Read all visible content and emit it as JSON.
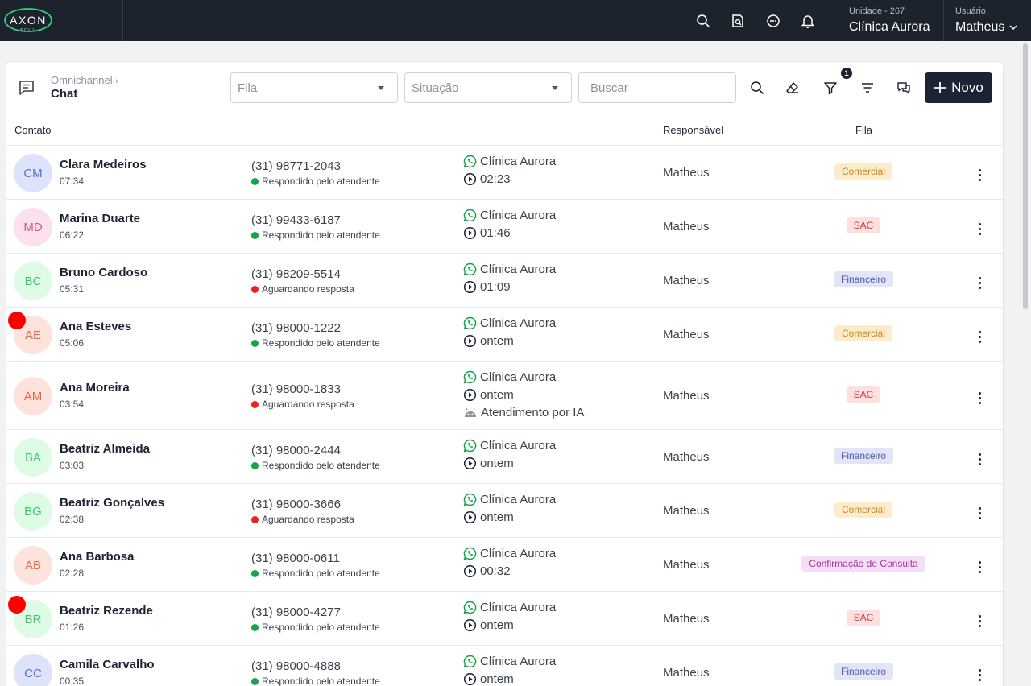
{
  "brand": {
    "logo_text": "AXON",
    "logo_sub": "SOUL"
  },
  "topbar": {
    "icons": [
      "search-icon",
      "document-search-icon",
      "chat-bubble-icon",
      "bell-icon"
    ],
    "unit_label": "Unidade - 267",
    "unit_name": "Clínica Aurora",
    "user_label": "Usuário",
    "user_name": "Matheus"
  },
  "header": {
    "breadcrumb": "Omnichannel",
    "title": "Chat",
    "fila_placeholder": "Fila",
    "situacao_placeholder": "Situação",
    "search_placeholder": "Buscar",
    "filter_badge": "1",
    "new_button": "Novo"
  },
  "columns": {
    "contato": "Contato",
    "responsavel": "Responsável",
    "fila": "Fila"
  },
  "colors": {
    "green": "#16a34a",
    "red": "#ef2020",
    "comercial_bg": "#fdeccc",
    "comercial_fg": "#c9881a",
    "sac_bg": "#fde0e0",
    "sac_fg": "#d63b3b",
    "financeiro_bg": "#e1e5f7",
    "financeiro_fg": "#4c5aa8",
    "confirmacao_bg": "#f4dff7",
    "confirmacao_fg": "#a4329f"
  },
  "rows": [
    {
      "initials": "CM",
      "name": "Clara Medeiros",
      "time": "07:34",
      "phone": "(31) 98771-2043",
      "status": "Respondido pelo atendente",
      "status_color": "green",
      "channel": "Clínica Aurora",
      "last": "02:23",
      "ai": "",
      "responsavel": "Matheus",
      "fila": "Comercial",
      "fila_kind": "comercial",
      "unread": false,
      "avatar_bg": "#dde3fb",
      "avatar_fg": "#5a6fcf"
    },
    {
      "initials": "MD",
      "name": "Marina Duarte",
      "time": "06:22",
      "phone": "(31) 99433-6187",
      "status": "Respondido pelo atendente",
      "status_color": "green",
      "channel": "Clínica Aurora",
      "last": "01:46",
      "ai": "",
      "responsavel": "Matheus",
      "fila": "SAC",
      "fila_kind": "sac",
      "unread": false,
      "avatar_bg": "#fce0ec",
      "avatar_fg": "#d4558a"
    },
    {
      "initials": "BC",
      "name": "Bruno Cardoso",
      "time": "05:31",
      "phone": "(31) 98209-5514",
      "status": "Aguardando resposta",
      "status_color": "red",
      "channel": "Clínica Aurora",
      "last": "01:09",
      "ai": "",
      "responsavel": "Matheus",
      "fila": "Financeiro",
      "fila_kind": "financeiro",
      "unread": false,
      "avatar_bg": "#defbe5",
      "avatar_fg": "#3fc46a"
    },
    {
      "initials": "AE",
      "name": "Ana Esteves",
      "time": "05:06",
      "phone": "(31) 98000-1222",
      "status": "Respondido pelo atendente",
      "status_color": "green",
      "channel": "Clínica Aurora",
      "last": "ontem",
      "ai": "",
      "responsavel": "Matheus",
      "fila": "Comercial",
      "fila_kind": "comercial",
      "unread": true,
      "avatar_bg": "#fde3dc",
      "avatar_fg": "#e0694a"
    },
    {
      "initials": "AM",
      "name": "Ana Moreira",
      "time": "03:54",
      "phone": "(31) 98000-1833",
      "status": "Aguardando resposta",
      "status_color": "red",
      "channel": "Clínica Aurora",
      "last": "ontem",
      "ai": "Atendimento por IA",
      "responsavel": "Matheus",
      "fila": "SAC",
      "fila_kind": "sac",
      "unread": false,
      "avatar_bg": "#fde3dc",
      "avatar_fg": "#e0694a"
    },
    {
      "initials": "BA",
      "name": "Beatriz Almeida",
      "time": "03:03",
      "phone": "(31) 98000-2444",
      "status": "Respondido pelo atendente",
      "status_color": "green",
      "channel": "Clínica Aurora",
      "last": "ontem",
      "ai": "",
      "responsavel": "Matheus",
      "fila": "Financeiro",
      "fila_kind": "financeiro",
      "unread": false,
      "avatar_bg": "#defbe5",
      "avatar_fg": "#3fc46a"
    },
    {
      "initials": "BG",
      "name": "Beatriz Gonçalves",
      "time": "02:38",
      "phone": "(31) 98000-3666",
      "status": "Aguardando resposta",
      "status_color": "red",
      "channel": "Clínica Aurora",
      "last": "ontem",
      "ai": "",
      "responsavel": "Matheus",
      "fila": "Comercial",
      "fila_kind": "comercial",
      "unread": false,
      "avatar_bg": "#defbe5",
      "avatar_fg": "#3fc46a"
    },
    {
      "initials": "AB",
      "name": "Ana Barbosa",
      "time": "02:28",
      "phone": "(31) 98000-0611",
      "status": "Respondido pelo atendente",
      "status_color": "green",
      "channel": "Clínica Aurora",
      "last": "00:32",
      "ai": "",
      "responsavel": "Matheus",
      "fila": "Confirmação de Consulta",
      "fila_kind": "confirmacao",
      "unread": false,
      "avatar_bg": "#fde3dc",
      "avatar_fg": "#e0694a"
    },
    {
      "initials": "BR",
      "name": "Beatriz Rezende",
      "time": "01:26",
      "phone": "(31) 98000-4277",
      "status": "Respondido pelo atendente",
      "status_color": "green",
      "channel": "Clínica Aurora",
      "last": "ontem",
      "ai": "",
      "responsavel": "Matheus",
      "fila": "SAC",
      "fila_kind": "sac",
      "unread": true,
      "avatar_bg": "#defbe5",
      "avatar_fg": "#3fc46a"
    },
    {
      "initials": "CC",
      "name": "Camila Carvalho",
      "time": "00:35",
      "phone": "(31) 98000-4888",
      "status": "Respondido pelo atendente",
      "status_color": "green",
      "channel": "Clínica Aurora",
      "last": "ontem",
      "ai": "",
      "responsavel": "Matheus",
      "fila": "Financeiro",
      "fila_kind": "financeiro",
      "unread": false,
      "avatar_bg": "#dde3fb",
      "avatar_fg": "#5a6fcf"
    }
  ]
}
